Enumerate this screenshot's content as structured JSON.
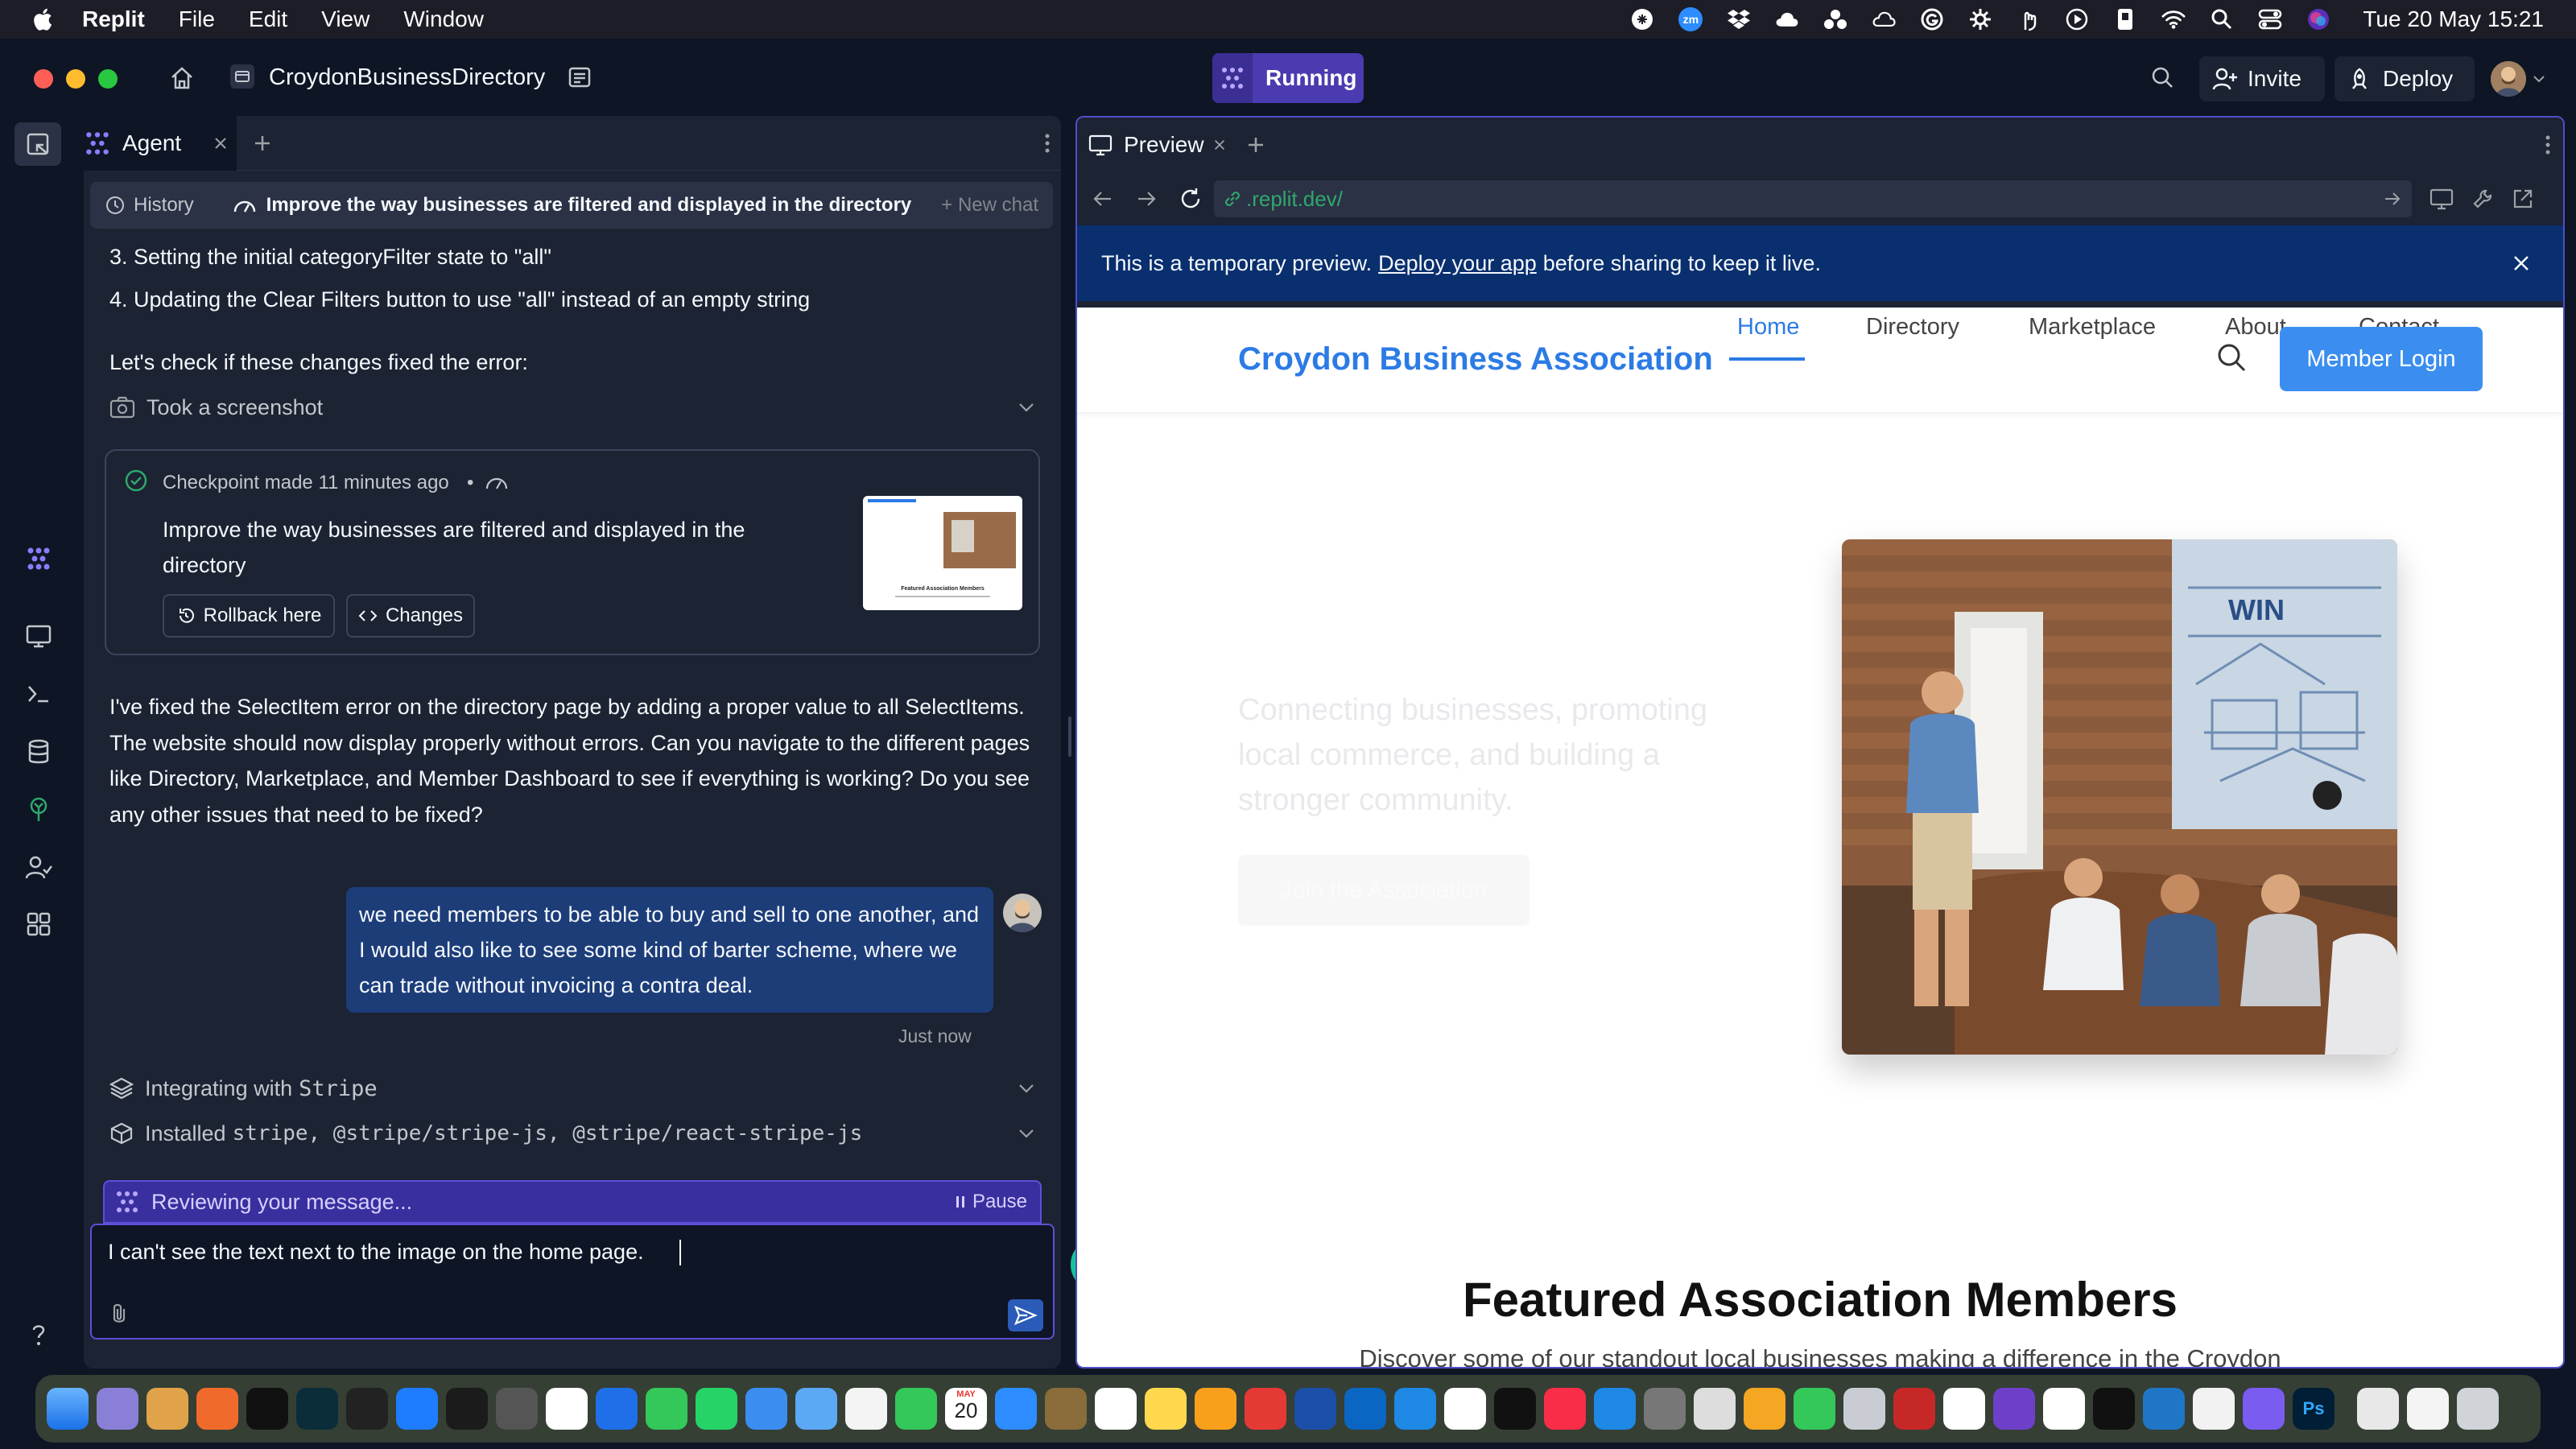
{
  "menubar": {
    "app": "Replit",
    "items": [
      "File",
      "Edit",
      "View",
      "Window"
    ],
    "datetime": "Tue 20 May  15:21",
    "zoom_label": "zm"
  },
  "titlebar": {
    "project_name": "CroydonBusinessDirectory",
    "run_status": "Running",
    "invite_label": "Invite",
    "deploy_label": "Deploy"
  },
  "agent": {
    "tab_label": "Agent",
    "history_label": "History",
    "thread_title": "Improve the way businesses are filtered and displayed in the directory",
    "new_chat_label": "+ New chat",
    "lines": {
      "step3": "3. Setting the initial categoryFilter state to \"all\"",
      "step4": "4. Updating the Clear Filters button to use \"all\" instead of an empty string",
      "check": "Let's check if these changes fixed the error:"
    },
    "screenshot_label": "Took a screenshot",
    "checkpoint": {
      "meta": "Checkpoint made 11 minutes ago",
      "dot": "•",
      "title": "Improve the way businesses are filtered and displayed in the directory",
      "rollback_label": "Rollback here",
      "changes_label": "Changes",
      "thumb_caption": "Featured Association Members"
    },
    "reply": "I've fixed the SelectItem error on the directory page by adding a proper value to all SelectItems. The website should now display properly without errors. Can you navigate to the different pages like Directory, Marketplace, and Member Dashboard to see if everything is working? Do you see any other issues that need to be fixed?",
    "user_message": "we need members to be able to buy and sell to one another, and I would also like to see some kind of barter scheme, where we can trade without invoicing a contra deal.",
    "user_time": "Just now",
    "action1_prefix": "Integrating with ",
    "action1_code": "Stripe",
    "action2_prefix": "Installed ",
    "action2_code": "stripe, @stripe/stripe-js, @stripe/react-stripe-js",
    "reviewing_label": "Reviewing your message...",
    "pause_label": "Pause",
    "input_value": "I can't see the text next to the image on the home page."
  },
  "preview": {
    "tab_label": "Preview",
    "url": ".replit.dev/",
    "banner": {
      "prefix": "This is a temporary preview. ",
      "link": "Deploy your app",
      "suffix": " before sharing to keep it live."
    },
    "site": {
      "brand": "Croydon Business Association",
      "nav": [
        "Home",
        "Directory",
        "Marketplace",
        "About",
        "Contact"
      ],
      "login_label": "Member Login",
      "hero_text": "Connecting businesses, promoting local commerce, and building a stronger community.",
      "hero_button": "Join the Association",
      "poster_text": "WIN",
      "featured_title": "Featured Association Members",
      "featured_sub": "Discover some of our standout local businesses making a difference in the Croydon"
    }
  },
  "dock": {
    "calendar_month": "MAY",
    "calendar_day": "20",
    "photoshop_label": "Ps"
  },
  "colors": {
    "accent_purple": "#5f4ed8",
    "brand_blue": "#2c7be5",
    "login_blue": "#3b8ef0",
    "user_bubble": "#1d3d79",
    "banner_blue": "#0a2f6e"
  }
}
